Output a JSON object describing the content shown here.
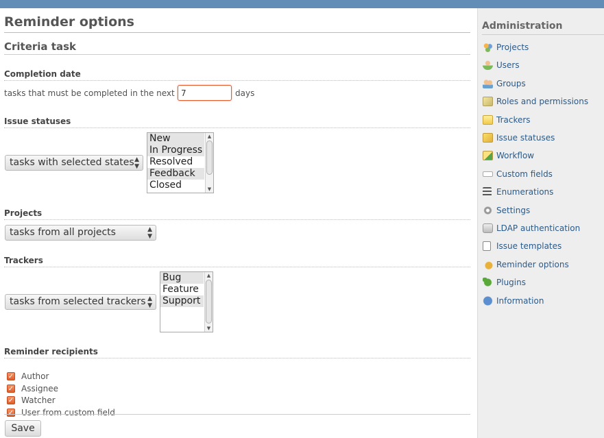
{
  "page": {
    "title": "Reminder options",
    "subtitle": "Criteria task"
  },
  "completion": {
    "heading": "Completion date",
    "prefix": "tasks that must be completed in the next",
    "value": "7",
    "suffix": "days"
  },
  "statuses": {
    "heading": "Issue statuses",
    "mode": "tasks with selected states",
    "options": [
      {
        "label": "New",
        "selected": true
      },
      {
        "label": "In Progress",
        "selected": true
      },
      {
        "label": "Resolved",
        "selected": false
      },
      {
        "label": "Feedback",
        "selected": true
      },
      {
        "label": "Closed",
        "selected": false
      }
    ]
  },
  "projects": {
    "heading": "Projects",
    "mode": "tasks from all projects"
  },
  "trackers": {
    "heading": "Trackers",
    "mode": "tasks from selected trackers",
    "options": [
      {
        "label": "Bug",
        "selected": true
      },
      {
        "label": "Feature",
        "selected": false
      },
      {
        "label": "Support",
        "selected": true
      }
    ]
  },
  "recipients": {
    "heading": "Reminder recipients",
    "items": [
      {
        "label": "Author",
        "checked": true
      },
      {
        "label": "Assignee",
        "checked": true
      },
      {
        "label": "Watcher",
        "checked": true
      },
      {
        "label": "User from custom field",
        "checked": true
      }
    ]
  },
  "actions": {
    "save_label": "Save"
  },
  "sidebar": {
    "title": "Administration",
    "items": [
      {
        "label": "Projects",
        "icon": "projects-icon"
      },
      {
        "label": "Users",
        "icon": "user-icon"
      },
      {
        "label": "Groups",
        "icon": "group-icon"
      },
      {
        "label": "Roles and permissions",
        "icon": "roles-icon"
      },
      {
        "label": "Trackers",
        "icon": "tracker-icon"
      },
      {
        "label": "Issue statuses",
        "icon": "issue-status-icon"
      },
      {
        "label": "Workflow",
        "icon": "workflow-icon"
      },
      {
        "label": "Custom fields",
        "icon": "custom-fields-icon"
      },
      {
        "label": "Enumerations",
        "icon": "list-icon"
      },
      {
        "label": "Settings",
        "icon": "gear-icon"
      },
      {
        "label": "LDAP authentication",
        "icon": "ldap-icon"
      },
      {
        "label": "Issue templates",
        "icon": "template-icon"
      },
      {
        "label": "Reminder options",
        "icon": "bell-icon"
      },
      {
        "label": "Plugins",
        "icon": "plugin-icon"
      },
      {
        "label": "Information",
        "icon": "info-icon"
      }
    ]
  },
  "colors": {
    "header_bar": "#628db6",
    "link": "#2a5a8a",
    "checkbox": "#e15f2a",
    "sidebar_bg": "#eeeeee"
  }
}
